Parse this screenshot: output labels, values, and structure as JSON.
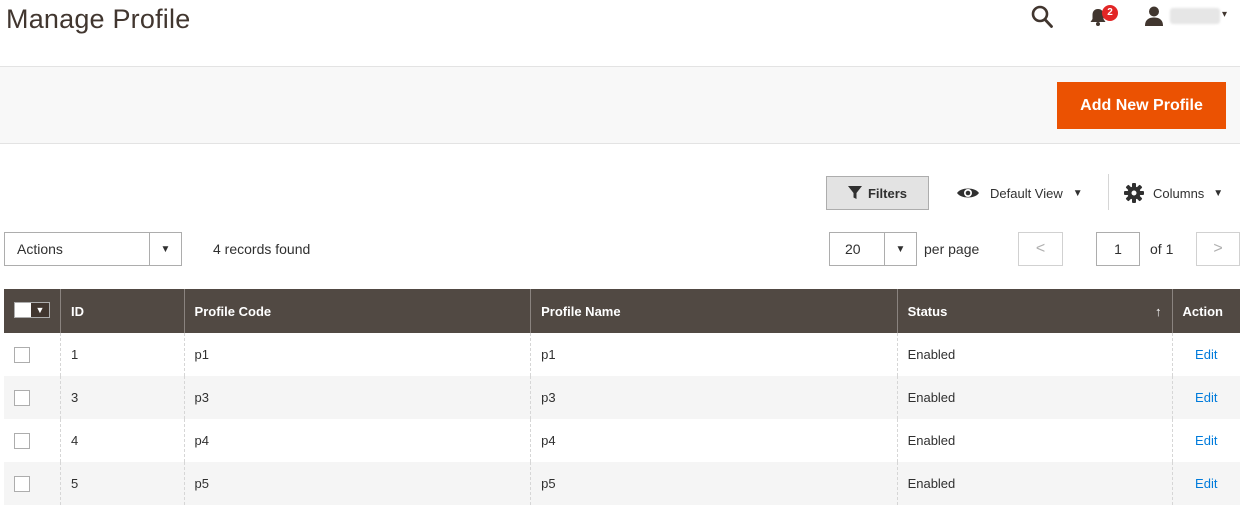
{
  "header": {
    "title": "Manage Profile",
    "notifications_count": "2",
    "user_caret": "▾"
  },
  "toolbar": {
    "add_button_label": "Add New Profile"
  },
  "grid_controls": {
    "filters_label": "Filters",
    "view_label": "Default View",
    "columns_label": "Columns",
    "actions_label": "Actions",
    "records_found": "4 records found",
    "per_page_value": "20",
    "per_page_label": "per page",
    "page_value": "1",
    "page_total": "of 1",
    "prev_label": "<",
    "next_label": ">"
  },
  "table": {
    "columns": [
      "ID",
      "Profile Code",
      "Profile Name",
      "Status",
      "Action"
    ],
    "sort_indicator": "↑",
    "rows": [
      {
        "id": "1",
        "code": "p1",
        "name": "p1",
        "status": "Enabled",
        "action": "Edit"
      },
      {
        "id": "3",
        "code": "p3",
        "name": "p3",
        "status": "Enabled",
        "action": "Edit"
      },
      {
        "id": "4",
        "code": "p4",
        "name": "p4",
        "status": "Enabled",
        "action": "Edit"
      },
      {
        "id": "5",
        "code": "p5",
        "name": "p5",
        "status": "Enabled",
        "action": "Edit"
      }
    ]
  },
  "colors": {
    "accent": "#eb5202",
    "table_header": "#514943",
    "link": "#007bdb",
    "badge": "#e22626"
  },
  "icons": [
    "search-icon",
    "bell-icon",
    "user-icon",
    "filter-icon",
    "eye-icon",
    "gear-icon"
  ]
}
